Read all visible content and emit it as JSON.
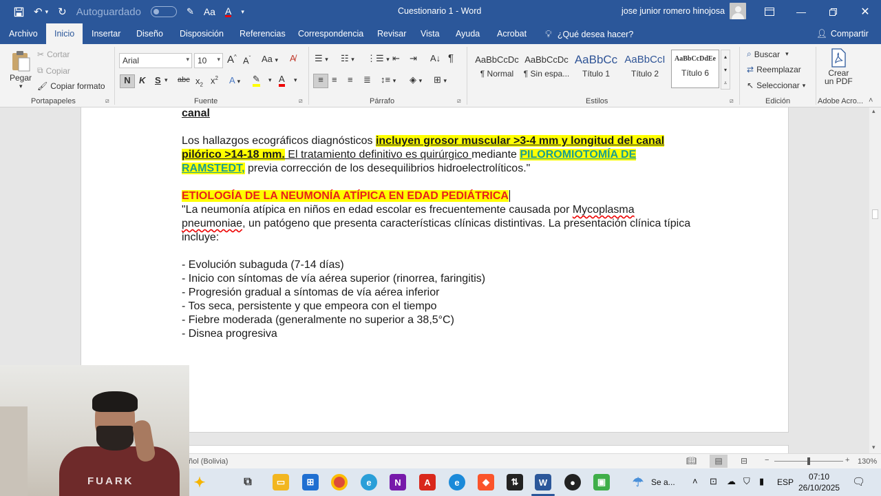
{
  "titlebar": {
    "autosave_label": "Autoguardado",
    "document_title": "Cuestionario 1  -  Word",
    "user_name": "jose junior romero hinojosa"
  },
  "tabs": [
    {
      "label": "Archivo"
    },
    {
      "label": "Inicio"
    },
    {
      "label": "Insertar"
    },
    {
      "label": "Diseño"
    },
    {
      "label": "Disposición"
    },
    {
      "label": "Referencias"
    },
    {
      "label": "Correspondencia"
    },
    {
      "label": "Revisar"
    },
    {
      "label": "Vista"
    },
    {
      "label": "Ayuda"
    },
    {
      "label": "Acrobat"
    }
  ],
  "tell_me": "¿Qué desea hacer?",
  "share_label": "Compartir",
  "ribbon": {
    "clipboard": {
      "paste": "Pegar",
      "cut": "Cortar",
      "copy": "Copiar",
      "format_painter": "Copiar formato",
      "group": "Portapapeles"
    },
    "font": {
      "family": "Arial",
      "size": "10",
      "group": "Fuente"
    },
    "paragraph": {
      "group": "Párrafo"
    },
    "styles": {
      "group": "Estilos",
      "items": [
        {
          "preview": "AaBbCcDc",
          "name": "¶ Normal"
        },
        {
          "preview": "AaBbCcDc",
          "name": "¶ Sin espa..."
        },
        {
          "preview": "AaBbCc",
          "name": "Título 1"
        },
        {
          "preview": "AaBbCcI",
          "name": "Título 2"
        },
        {
          "preview": "AaBbCcDdEe",
          "name": "Título 6"
        }
      ]
    },
    "editing": {
      "find": "Buscar",
      "replace": "Reemplazar",
      "select": "Seleccionar",
      "group": "Edición"
    },
    "acrobat": {
      "create_pdf_line1": "Crear",
      "create_pdf_line2": "un PDF",
      "group": "Adobe Acro..."
    }
  },
  "document": {
    "top_fragment": "canal",
    "para1": {
      "a": "Los hallazgos ecográficos diagnósticos ",
      "b": "incluyen grosor muscular >3-4 mm y longitud del canal pilórico >14-18 mm.",
      "c": " El tratamiento definitivo es quirúrgico ",
      "d": "mediante ",
      "e": "PILOROMIOTOMÍA DE RAMSTEDT,",
      "f": " previa corrección de los desequilibrios hidroelectrolíticos.\""
    },
    "heading": "ETIOLOGÍA DE LA NEUMONÍA ATÍPICA EN EDAD PEDIÁTRICA",
    "para2": {
      "a": "\"La neumonía atípica en niños en edad escolar es frecuentemente causada por ",
      "b": "Mycoplasma pneumoniae",
      "c": ", un patógeno que presenta características clínicas distintivas. La presentación clínica típica incluye:"
    },
    "bullets": [
      "- Evolución subaguda (7-14 días)",
      "- Inicio con síntomas de vía aérea superior (rinorrea, faringitis)",
      "- Progresión gradual a síntomas de vía aérea inferior",
      "- Tos seca, persistente y que empeora con el tiempo",
      "- Fiebre moderada (generalmente no superior a 38,5°C)",
      "- Disnea progresiva"
    ]
  },
  "statusbar": {
    "language": "ñol (Bolivia)",
    "zoom": "130%"
  },
  "taskbar": {
    "weather_label": "Se a...",
    "input_lang": "ESP",
    "time": "07:10",
    "date": "26/10/2025"
  },
  "webcam": {
    "shirt_text": "FUARK"
  },
  "colors": {
    "word_blue": "#2b579a",
    "highlight": "#ffff00",
    "heading_red": "#e8201a",
    "teal": "#1a9e8e"
  }
}
